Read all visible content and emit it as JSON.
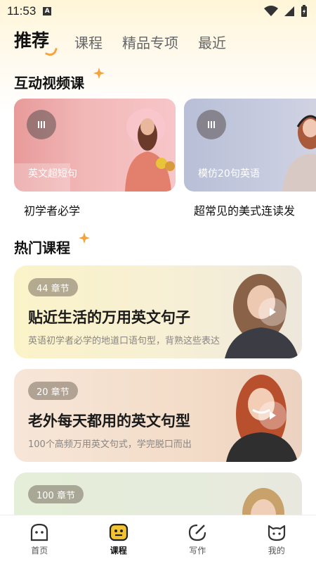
{
  "status": {
    "time": "11:53"
  },
  "tabs": [
    {
      "label": "推荐",
      "active": true
    },
    {
      "label": "课程",
      "active": false
    },
    {
      "label": "精品专项",
      "active": false
    },
    {
      "label": "最近",
      "active": false
    }
  ],
  "interactive_section": {
    "title": "互动视频课",
    "cards": [
      {
        "overlay": "英文超短句",
        "caption": "初学者必学"
      },
      {
        "overlay": "模仿20句英语",
        "caption": "超常见的美式连读发"
      }
    ]
  },
  "hot_section": {
    "title": "热门课程",
    "courses": [
      {
        "chapters": "44 章节",
        "title": "贴近生活的万用英文句子",
        "desc": "英语初学者必学的地道口语句型，背熟这些表达"
      },
      {
        "chapters": "20 章节",
        "title": "老外每天都用的英文句型",
        "desc": "100个高频万用英文句式，学完脱口而出"
      },
      {
        "chapters": "100 章节",
        "title": "",
        "desc": ""
      }
    ]
  },
  "bottom_nav": [
    {
      "label": "首页",
      "icon": "home-face-icon",
      "active": false
    },
    {
      "label": "课程",
      "icon": "course-icon",
      "active": true
    },
    {
      "label": "写作",
      "icon": "write-icon",
      "active": false
    },
    {
      "label": "我的",
      "icon": "profile-cat-icon",
      "active": false
    }
  ],
  "colors": {
    "accent": "#f3c332",
    "sparkle": "#f3a43a"
  }
}
